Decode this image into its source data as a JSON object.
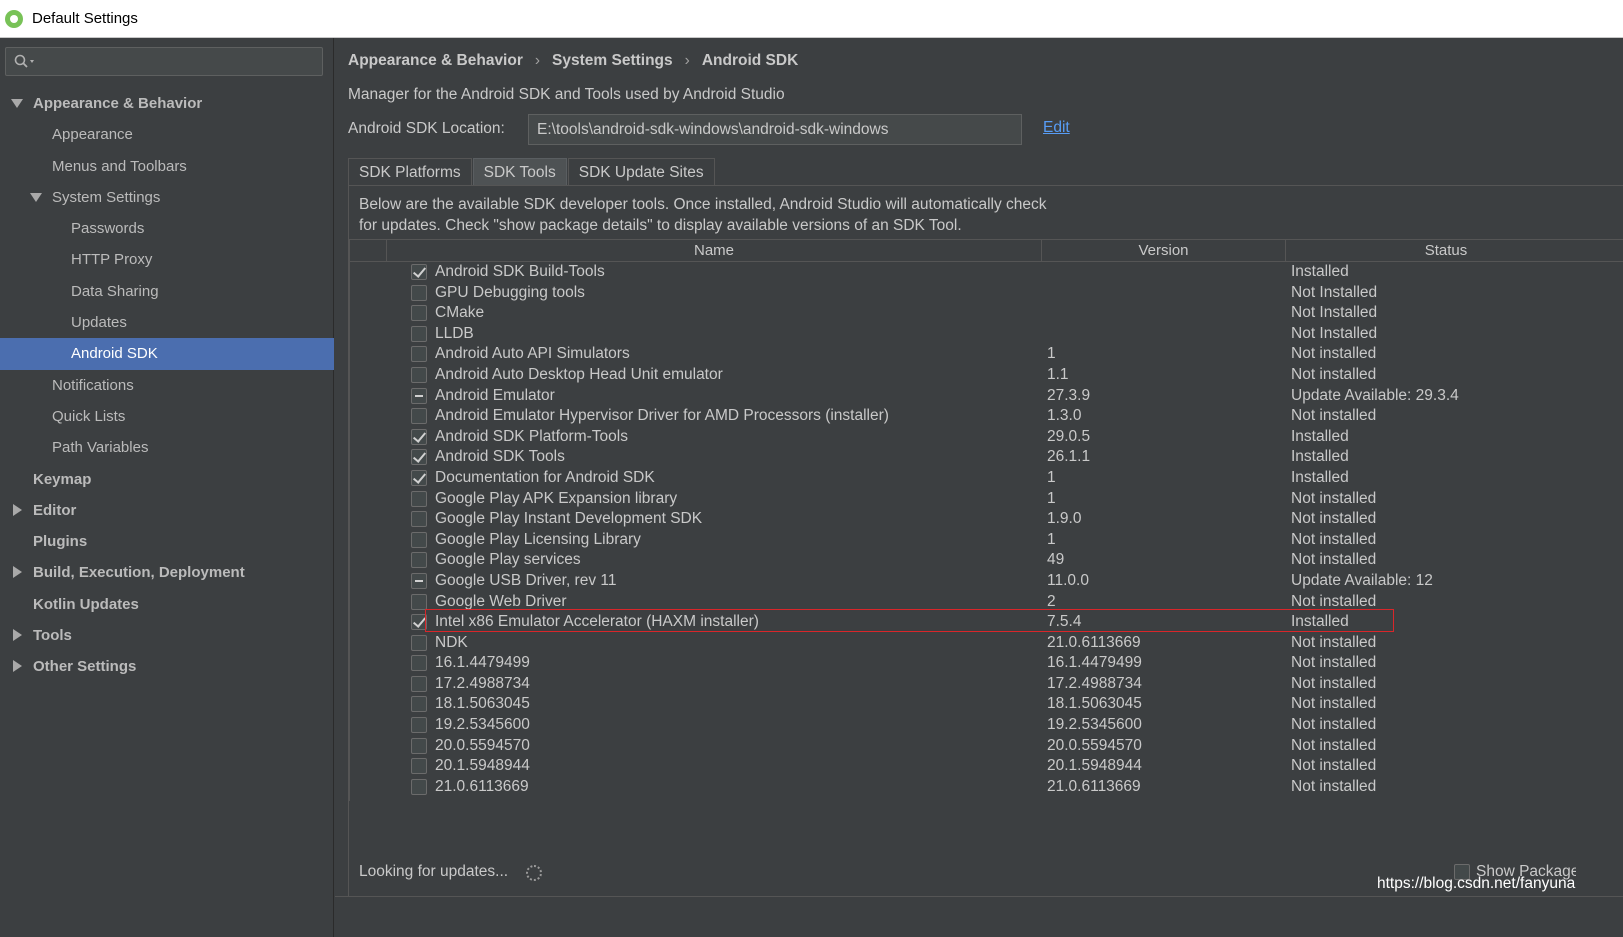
{
  "window": {
    "title": "Default Settings"
  },
  "search": {
    "placeholder": ""
  },
  "sidebar": {
    "items": [
      {
        "label": "Appearance & Behavior",
        "level": 0,
        "bold": true,
        "arrow": "down"
      },
      {
        "label": "Appearance",
        "level": 1
      },
      {
        "label": "Menus and Toolbars",
        "level": 1
      },
      {
        "label": "System Settings",
        "level": 1,
        "arrow": "down"
      },
      {
        "label": "Passwords",
        "level": 2
      },
      {
        "label": "HTTP Proxy",
        "level": 2
      },
      {
        "label": "Data Sharing",
        "level": 2
      },
      {
        "label": "Updates",
        "level": 2
      },
      {
        "label": "Android SDK",
        "level": 2,
        "selected": true
      },
      {
        "label": "Notifications",
        "level": 1
      },
      {
        "label": "Quick Lists",
        "level": 1
      },
      {
        "label": "Path Variables",
        "level": 1
      },
      {
        "label": "Keymap",
        "level": 0,
        "bold": true
      },
      {
        "label": "Editor",
        "level": 0,
        "bold": true,
        "arrow": "right"
      },
      {
        "label": "Plugins",
        "level": 0,
        "bold": true
      },
      {
        "label": "Build, Execution, Deployment",
        "level": 0,
        "bold": true,
        "arrow": "right"
      },
      {
        "label": "Kotlin Updates",
        "level": 0,
        "bold": true
      },
      {
        "label": "Tools",
        "level": 0,
        "bold": true,
        "arrow": "right"
      },
      {
        "label": "Other Settings",
        "level": 0,
        "bold": true,
        "arrow": "right"
      }
    ]
  },
  "breadcrumb": {
    "part1": "Appearance & Behavior",
    "part2": "System Settings",
    "part3": "Android SDK",
    "separator": "›"
  },
  "main": {
    "description": "Manager for the Android SDK and Tools used by Android Studio",
    "sdk_location_label": "Android SDK Location:",
    "sdk_location_value": "E:\\tools\\android-sdk-windows\\android-sdk-windows",
    "edit_label": "Edit",
    "tabs": [
      {
        "label": "SDK Platforms",
        "active": false
      },
      {
        "label": "SDK Tools",
        "active": true
      },
      {
        "label": "SDK Update Sites",
        "active": false
      }
    ],
    "panel_desc_line1": "Below are the available SDK developer tools. Once installed, Android Studio will automatically check",
    "panel_desc_line2": "for updates. Check \"show package details\" to display available versions of an SDK Tool.",
    "columns": {
      "name": "Name",
      "version": "Version",
      "status": "Status"
    },
    "rows": [
      {
        "name": "Android SDK Build-Tools",
        "version": "",
        "status": "Installed",
        "check": "checked"
      },
      {
        "name": "GPU Debugging tools",
        "version": "",
        "status": "Not Installed",
        "check": "none"
      },
      {
        "name": "CMake",
        "version": "",
        "status": "Not Installed",
        "check": "none"
      },
      {
        "name": "LLDB",
        "version": "",
        "status": "Not Installed",
        "check": "none"
      },
      {
        "name": "Android Auto API Simulators",
        "version": "1",
        "status": "Not installed",
        "check": "none"
      },
      {
        "name": "Android Auto Desktop Head Unit emulator",
        "version": "1.1",
        "status": "Not installed",
        "check": "none"
      },
      {
        "name": "Android Emulator",
        "version": "27.3.9",
        "status": "Update Available: 29.3.4",
        "check": "partial"
      },
      {
        "name": "Android Emulator Hypervisor Driver for AMD Processors (installer)",
        "version": "1.3.0",
        "status": "Not installed",
        "check": "none"
      },
      {
        "name": "Android SDK Platform-Tools",
        "version": "29.0.5",
        "status": "Installed",
        "check": "checked"
      },
      {
        "name": "Android SDK Tools",
        "version": "26.1.1",
        "status": "Installed",
        "check": "checked"
      },
      {
        "name": "Documentation for Android SDK",
        "version": "1",
        "status": "Installed",
        "check": "checked"
      },
      {
        "name": "Google Play APK Expansion library",
        "version": "1",
        "status": "Not installed",
        "check": "none"
      },
      {
        "name": "Google Play Instant Development SDK",
        "version": "1.9.0",
        "status": "Not installed",
        "check": "none"
      },
      {
        "name": "Google Play Licensing Library",
        "version": "1",
        "status": "Not installed",
        "check": "none"
      },
      {
        "name": "Google Play services",
        "version": "49",
        "status": "Not installed",
        "check": "none"
      },
      {
        "name": "Google USB Driver, rev 11",
        "version": "11.0.0",
        "status": "Update Available: 12",
        "check": "partial"
      },
      {
        "name": "Google Web Driver",
        "version": "2",
        "status": "Not installed",
        "check": "none"
      },
      {
        "name": "Intel x86 Emulator Accelerator (HAXM installer)",
        "version": "7.5.4",
        "status": "Installed",
        "check": "checked"
      },
      {
        "name": "NDK",
        "version": "21.0.6113669",
        "status": "Not installed",
        "check": "none"
      },
      {
        "name": "16.1.4479499",
        "version": "16.1.4479499",
        "status": "Not installed",
        "check": "none"
      },
      {
        "name": "17.2.4988734",
        "version": "17.2.4988734",
        "status": "Not installed",
        "check": "none"
      },
      {
        "name": "18.1.5063045",
        "version": "18.1.5063045",
        "status": "Not installed",
        "check": "none"
      },
      {
        "name": "19.2.5345600",
        "version": "19.2.5345600",
        "status": "Not installed",
        "check": "none"
      },
      {
        "name": "20.0.5594570",
        "version": "20.0.5594570",
        "status": "Not installed",
        "check": "none"
      },
      {
        "name": "20.1.5948944",
        "version": "20.1.5948944",
        "status": "Not installed",
        "check": "none"
      },
      {
        "name": "21.0.6113669",
        "version": "21.0.6113669",
        "status": "Not installed",
        "check": "none"
      }
    ],
    "looking_text": "Looking for updates...",
    "show_package_label": "Show Package Details",
    "watermark": "https://blog.csdn.net/fanyuna"
  },
  "colors": {
    "background": "#3c3f41",
    "selection": "#4b6eaf",
    "link": "#589df6",
    "highlight_border": "#d9262a"
  }
}
